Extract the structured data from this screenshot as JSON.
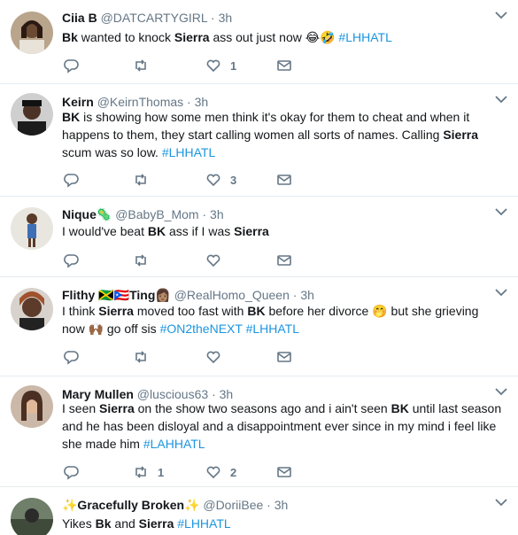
{
  "tweets": [
    {
      "name": "Ciia B",
      "handle": "@DATCARTYGIRL",
      "time": "3h",
      "name_suffix": "",
      "body": [
        {
          "t": "Bk",
          "b": true
        },
        {
          "t": " wanted to knock "
        },
        {
          "t": "Sierra",
          "b": true
        },
        {
          "t": " ass out just now 😂🤣 "
        },
        {
          "t": "#LHHATL",
          "tag": true
        }
      ],
      "replies": "",
      "retweets": "",
      "likes": "1"
    },
    {
      "name": "Keirn",
      "handle": "@KeirnThomas",
      "time": "3h",
      "name_suffix": "",
      "body": [
        {
          "t": "BK",
          "b": true
        },
        {
          "t": " is showing how some men think it's okay for them to cheat and when it happens to them, they start calling women all sorts of names. Calling "
        },
        {
          "t": "Sierra",
          "b": true
        },
        {
          "t": " scum was so low. "
        },
        {
          "t": "#LHHATL",
          "tag": true
        }
      ],
      "replies": "",
      "retweets": "",
      "likes": "3"
    },
    {
      "name": "Nique🦠",
      "handle": "@BabyB_Mom",
      "time": "3h",
      "name_suffix": "",
      "body": [
        {
          "t": "I would've beat "
        },
        {
          "t": "BK",
          "b": true
        },
        {
          "t": " ass if I was "
        },
        {
          "t": "Sierra",
          "b": true
        }
      ],
      "replies": "",
      "retweets": "",
      "likes": ""
    },
    {
      "name": "Flithy 🇯🇲🇵🇷Ting👩🏽",
      "handle": "@RealHomo_Queen",
      "time": "3h",
      "name_suffix": "",
      "body": [
        {
          "t": "I think "
        },
        {
          "t": "Sierra",
          "b": true
        },
        {
          "t": " moved too fast with "
        },
        {
          "t": "BK",
          "b": true
        },
        {
          "t": " before her divorce 🤭 but she grieving now 🙌🏾 go off sis "
        },
        {
          "t": "#ON2theNEXT",
          "tag": true
        },
        {
          "t": " "
        },
        {
          "t": "#LHHATL",
          "tag": true
        }
      ],
      "replies": "",
      "retweets": "",
      "likes": ""
    },
    {
      "name": "Mary Mullen",
      "handle": "@luscious63",
      "time": "3h",
      "name_suffix": "",
      "body": [
        {
          "t": "I seen "
        },
        {
          "t": "Sierra",
          "b": true
        },
        {
          "t": " on the show two seasons ago and i ain't seen "
        },
        {
          "t": "BK",
          "b": true
        },
        {
          "t": " until last season and he has been disloyal and a disappointment ever since in my mind i feel like she made him "
        },
        {
          "t": "#LAHHATL",
          "tag": true
        }
      ],
      "replies": "",
      "retweets": "1",
      "likes": "2"
    },
    {
      "name": "✨Gracefully Broken✨",
      "handle": "@DoriiBee",
      "time": "3h",
      "name_suffix": "",
      "body": [
        {
          "t": "Yikes "
        },
        {
          "t": "Bk",
          "b": true
        },
        {
          "t": " and "
        },
        {
          "t": "Sierra",
          "b": true
        },
        {
          "t": " "
        },
        {
          "t": "#LHHATL",
          "tag": true
        }
      ],
      "replies": "",
      "retweets": "",
      "likes": ""
    }
  ],
  "colors": {
    "text": "#14171a",
    "muted": "#657786",
    "hashtag": "#1b95e0",
    "divider": "#e6ecf0"
  },
  "icons": {
    "reply": "reply-icon",
    "retweet": "retweet-icon",
    "like": "heart-icon",
    "dm": "envelope-icon",
    "menu": "chevron-down-icon"
  }
}
